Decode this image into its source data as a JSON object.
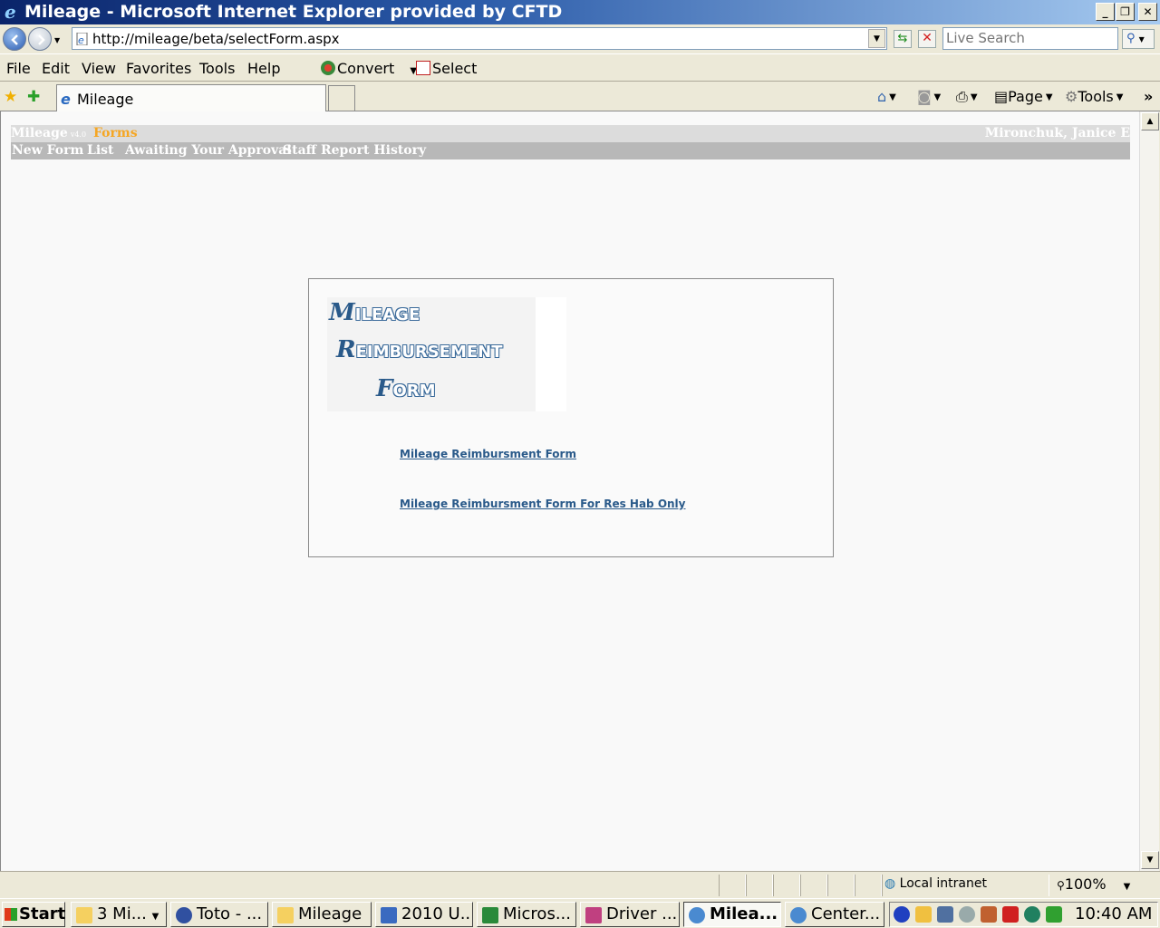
{
  "window": {
    "title": "Mileage - Microsoft Internet Explorer provided by CFTD"
  },
  "address": {
    "url": "http://mileage/beta/selectForm.aspx",
    "search_placeholder": "Live Search"
  },
  "menu": [
    "File",
    "Edit",
    "View",
    "Favorites",
    "Tools",
    "Help"
  ],
  "toolbar": {
    "convert": "Convert",
    "select": "Select"
  },
  "tabs": {
    "active": "Mileage"
  },
  "commands": {
    "page": "Page",
    "tools": "Tools"
  },
  "app": {
    "brand": "Mileage",
    "version": "v4.0",
    "section": "Forms",
    "user": "Mironchuk, Janice E",
    "nav": [
      "New Form",
      "List",
      "Awaiting Your Approval",
      "Staff Report History"
    ]
  },
  "logo": {
    "line1_cap": "M",
    "line1_rest": "ILEAGE",
    "line2_cap": "R",
    "line2_rest": "EIMBURSEMENT",
    "line3_cap": "F",
    "line3_rest": "ORM"
  },
  "links": [
    "Mileage Reimbursment Form",
    "Mileage Reimbursment Form For Res Hab Only"
  ],
  "status": {
    "zone": "Local intranet",
    "zoom": "100%"
  },
  "taskbar": {
    "start": "Start",
    "tasks": [
      "3 Mi...",
      "Toto - ...",
      "Mileage",
      "2010 U...",
      "Micros...",
      "Driver ...",
      "Milea...",
      "Center..."
    ],
    "clock": "10:40 AM"
  }
}
